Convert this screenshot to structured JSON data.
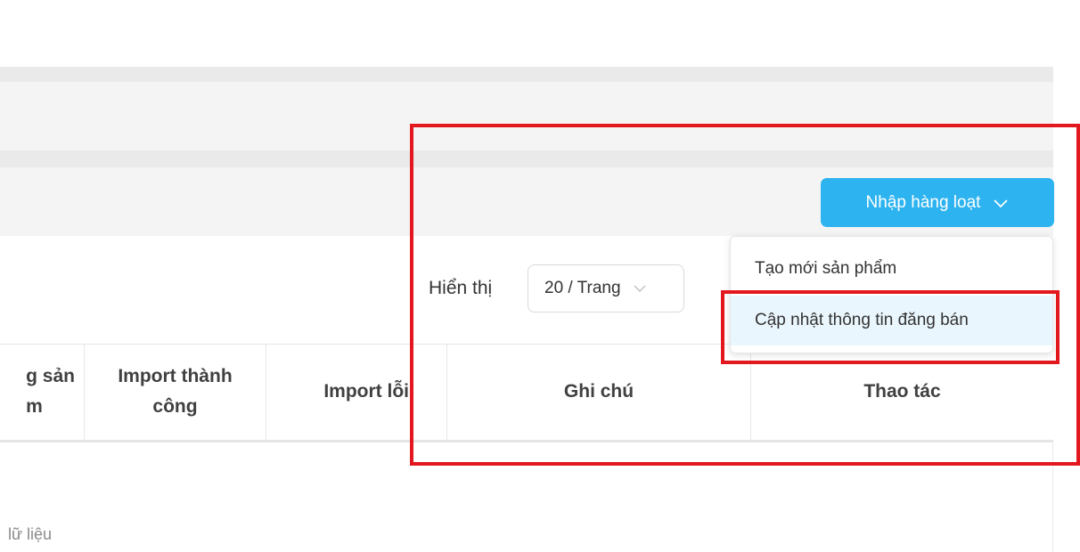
{
  "header": {
    "bulk_import_button": "Nhập hàng loạt"
  },
  "bulk_menu": {
    "items": [
      {
        "label": "Tạo mới sản phẩm"
      },
      {
        "label": "Cập nhật thông tin đăng bán"
      }
    ]
  },
  "pagination": {
    "show_label": "Hiển thị",
    "page_size": "20 / Trang"
  },
  "table": {
    "columns": [
      {
        "label": "g sản\nm"
      },
      {
        "label": "Import thành\ncông"
      },
      {
        "label": "Import lỗi"
      },
      {
        "label": "Ghi chú"
      },
      {
        "label": "Thao tác"
      }
    ],
    "empty_text": "lữ liệu"
  },
  "colors": {
    "accent": "#2db3ef",
    "annotation_red": "#e3171e",
    "menu_highlight": "#eaf6fd"
  },
  "icons": {
    "bulk_button_icon": "chevron-down-icon",
    "select_icon": "chevron-down-icon"
  }
}
